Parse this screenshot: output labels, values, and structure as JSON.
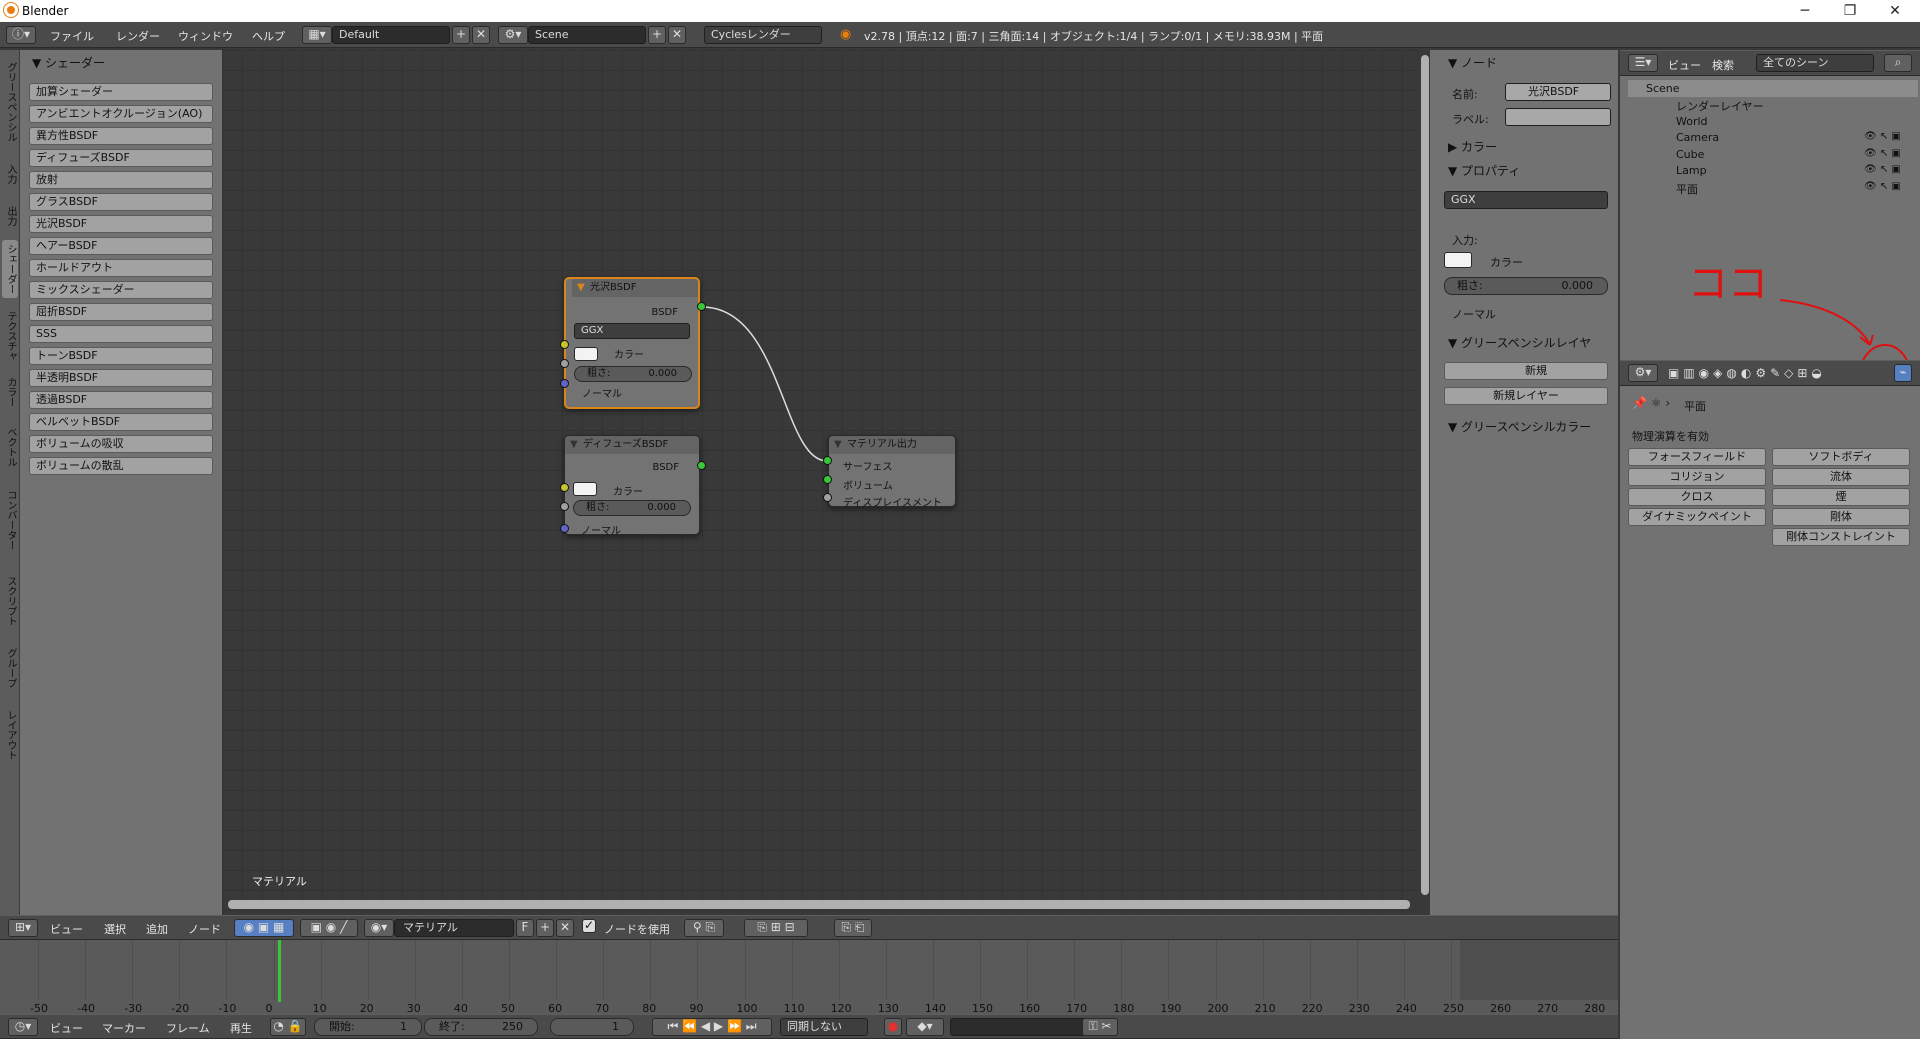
{
  "window": {
    "title": "Blender",
    "minimize": "─",
    "restore": "❐",
    "close": "✕"
  },
  "info": {
    "menus": [
      "ファイル",
      "レンダー",
      "ウィンドウ",
      "ヘルプ"
    ],
    "layout": "Default",
    "scene": "Scene",
    "engine": "Cyclesレンダー",
    "stats": "v2.78 | 頂点:12 | 面:7 | 三角面:14 | オブジェクト:1/4 | ランプ:0/1 | メモリ:38.93M | 平面"
  },
  "toolshelf": {
    "header": "▼ シェーダー",
    "tabs": [
      "グリースペンシル",
      "入力",
      "出力",
      "シェーダー",
      "テクスチャ",
      "カラー",
      "ベクトル",
      "コンバーター",
      "スクリプト",
      "グループ",
      "レイアウト"
    ],
    "active_tab": "シェーダー",
    "buttons": [
      "加算シェーダー",
      "アンビエントオクルージョン(AO)",
      "異方性BSDF",
      "ディフューズBSDF",
      "放射",
      "グラスBSDF",
      "光沢BSDF",
      "ヘアーBSDF",
      "ホールドアウト",
      "ミックスシェーダー",
      "屈折BSDF",
      "SSS",
      "トーンBSDF",
      "半透明BSDF",
      "透過BSDF",
      "ベルベットBSDF",
      "ボリュームの吸収",
      "ボリュームの散乱"
    ]
  },
  "nodes": {
    "glossy": {
      "title": "光沢BSDF",
      "out": "BSDF",
      "dist": "GGX",
      "color": "カラー",
      "rough_label": "粗さ:",
      "rough": "0.000",
      "normal": "ノーマル"
    },
    "diffuse": {
      "title": "ディフューズBSDF",
      "out": "BSDF",
      "color": "カラー",
      "rough_label": "粗さ:",
      "rough": "0.000",
      "normal": "ノーマル"
    },
    "output": {
      "title": "マテリアル出力",
      "surface": "サーフェス",
      "volume": "ボリューム",
      "disp": "ディスプレイスメント"
    },
    "canvas_label": "マテリアル"
  },
  "nprops": {
    "node_header": "▼ ノード",
    "name_label": "名前:",
    "name": "光沢BSDF",
    "label_label": "ラベル:",
    "color_header": "▶ カラー",
    "props_header": "▼ プロパティ",
    "dist": "GGX",
    "input_label": "入力:",
    "color": "カラー",
    "rough_label": "粗さ:",
    "rough": "0.000",
    "normal": "ノーマル",
    "gp_layer": "▼ グリースペンシルレイヤ",
    "new": "新規",
    "new_layer": "新規レイヤー",
    "gp_color": "▼ グリースペンシルカラー"
  },
  "outliner": {
    "menus": [
      "ビュー",
      "検索"
    ],
    "filter": "全てのシーン",
    "items": [
      "Scene",
      "レンダーレイヤー",
      "World",
      "Camera",
      "Cube",
      "Lamp",
      "平面"
    ]
  },
  "annotation": {
    "text": "ココ",
    "color": "#e01010"
  },
  "properties": {
    "breadcrumb": "平面",
    "section": "物理演算を有効",
    "buttons": [
      "フォースフィールド",
      "ソフトボディ",
      "コリジョン",
      "流体",
      "クロス",
      "煙",
      "ダイナミックペイント",
      "剛体",
      "剛体コンストレイント"
    ]
  },
  "node_header": {
    "menus": [
      "ビュー",
      "選択",
      "追加",
      "ノード"
    ],
    "material": "マテリアル",
    "f": "F",
    "use_nodes": "ノードを使用"
  },
  "timeline": {
    "ticks": [
      "-50",
      "-40",
      "-30",
      "-20",
      "-10",
      "0",
      "10",
      "20",
      "30",
      "40",
      "50",
      "60",
      "70",
      "80",
      "90",
      "100",
      "110",
      "120",
      "130",
      "140",
      "150",
      "160",
      "170",
      "180",
      "190",
      "200",
      "210",
      "220",
      "230",
      "240",
      "250",
      "260",
      "270",
      "280"
    ],
    "menus": [
      "ビュー",
      "マーカー",
      "フレーム",
      "再生"
    ],
    "start_label": "開始:",
    "start": "1",
    "end_label": "終了:",
    "end": "250",
    "current": "1",
    "sync": "同期しない"
  }
}
